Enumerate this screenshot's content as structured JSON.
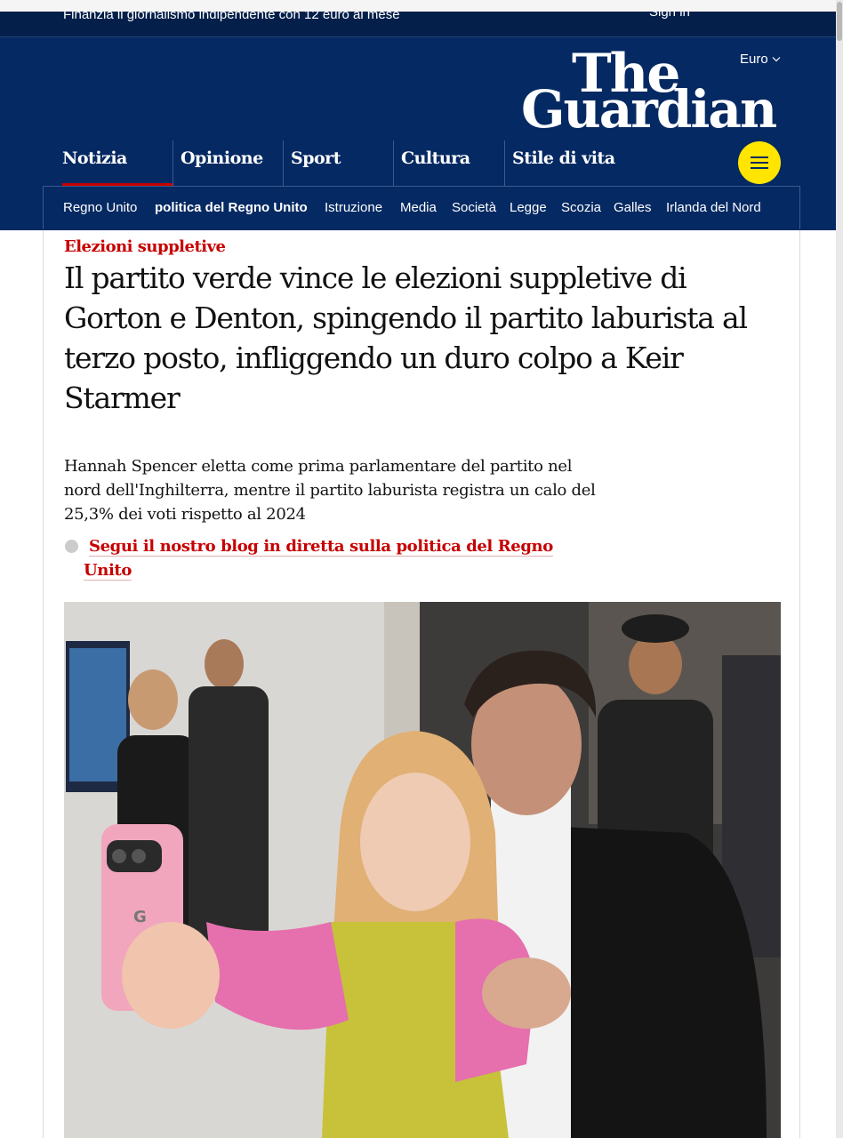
{
  "support_bar": {
    "text": "Finanzia il giornalismo indipendente con 12 euro al mese",
    "right_text": "Sign in"
  },
  "header": {
    "logo_line1": "The",
    "logo_line2": "Guardian",
    "edition_label": "Euro",
    "pillars": [
      {
        "label": "Notizia",
        "active": true
      },
      {
        "label": "Opinione",
        "active": false
      },
      {
        "label": "Sport",
        "active": false
      },
      {
        "label": "Cultura",
        "active": false
      },
      {
        "label": "Stile di vita",
        "active": false
      }
    ],
    "subnav": [
      {
        "label": "Regno Unito",
        "active": false
      },
      {
        "label": "politica del Regno Unito",
        "active": true
      },
      {
        "label": "Istruzione",
        "active": false
      },
      {
        "label": "Media",
        "active": false
      },
      {
        "label": "Società",
        "active": false
      },
      {
        "label": "Legge",
        "active": false
      },
      {
        "label": "Scozia",
        "active": false
      },
      {
        "label": "Galles",
        "active": false
      },
      {
        "label": "Irlanda del Nord",
        "active": false
      }
    ]
  },
  "article": {
    "kicker": "Elezioni suppletive",
    "headline": "Il partito verde vince le elezioni suppletive di Gorton e Denton, spingendo il partito laburista al terzo posto, infliggendo un duro colpo a Keir Starmer",
    "standfirst": "Hannah Spencer eletta come prima parlamentare del partito nel nord dell'Inghilterra, mentre il partito laburista registra un calo del 25,3% dei voti rispetto al 2024",
    "live_link": "Segui il nostro blog in diretta sulla politica del Regno Unito",
    "image_alt": "Hannah Spencer takes a selfie with a supporter at the count"
  },
  "colors": {
    "brand_blue": "#052962",
    "news_red": "#c70000",
    "menu_yellow": "#ffe500"
  }
}
